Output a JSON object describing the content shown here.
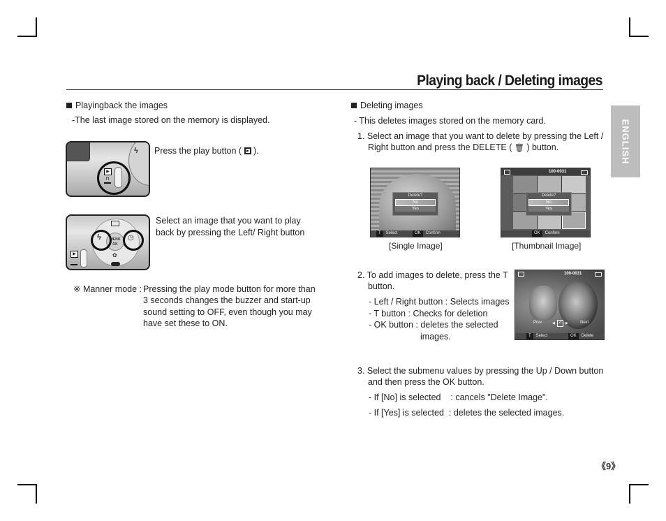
{
  "header": {
    "title": "Playing back / Deleting images"
  },
  "language_tab": "ENGLISH",
  "left_column": {
    "section_heading": "Playingback the images",
    "section_desc": "-The last image stored on the memory is displayed.",
    "step1_text": "Press the play button (",
    "step1_text_end": ").",
    "step2_line1": "Select an image that you want to play",
    "step2_line2": "back by pressing the Left/ Right button",
    "note_prefix": "※ Manner mode :",
    "note_lines": [
      "Pressing the play mode button for more than",
      "3 seconds changes the buzzer and start-up",
      "sound setting to OFF, even though you may",
      "have set these to ON."
    ],
    "camera_labels": {
      "menu": "MENU",
      "ok": "OK"
    }
  },
  "right_column": {
    "section_heading": "Deleting images",
    "section_desc": "- This deletes images stored on the memory card.",
    "step1_line1": "1. Select an image that you want to delete by pressing the Left /",
    "step1_line2_a": "Right button and press the DELETE (",
    "step1_line2_b": ") button.",
    "screens": {
      "single": {
        "caption": "[Single Image]",
        "dialog_question": "Delete?",
        "options": [
          "No",
          "Yes"
        ],
        "bottom_keys": [
          {
            "key": "T",
            "label": "Select"
          },
          {
            "key": "OK",
            "label": "Confirm"
          }
        ]
      },
      "thumbnail": {
        "caption": "[Thumbnail Image]",
        "file_number": "100-0031",
        "dialog_question": "Delete?",
        "options": [
          "No",
          "Yes"
        ],
        "bottom_keys": [
          {
            "key": "OK",
            "label": "Confirm"
          }
        ]
      },
      "multi": {
        "file_number": "100-0031",
        "prev_label": "Prev",
        "next_label": "Next",
        "bottom_keys": [
          {
            "key": "T",
            "label": "Select"
          },
          {
            "key": "OK",
            "label": "Delete"
          }
        ]
      }
    },
    "step2_line1": "2. To add images to delete, press the T",
    "step2_line2": "button.",
    "step2_items": [
      "- Left / Right button : Selects images",
      "- T button : Checks for deletion",
      "- OK button : deletes the selected"
    ],
    "step2_item3_cont": "images.",
    "step3_line1": "3. Select the submenu values by pressing the Up / Down button",
    "step3_line2": "and then press the OK button.",
    "step3_items": [
      "- If [No] is selected    : cancels \"Delete Image\".",
      "- If [Yes] is selected  : deletes the selected images."
    ]
  },
  "footer": {
    "page_number": "《9》"
  }
}
